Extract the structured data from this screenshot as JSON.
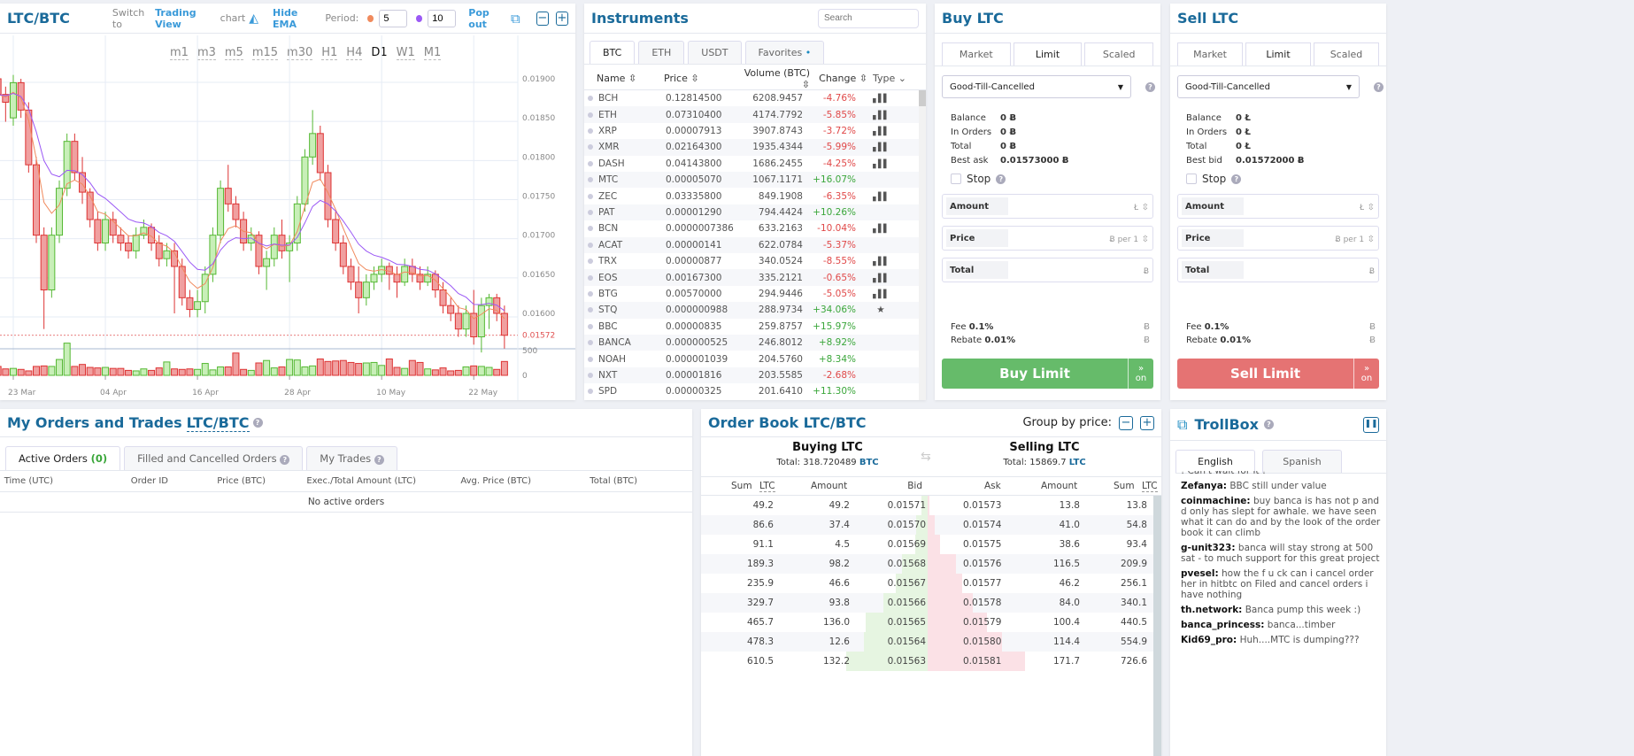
{
  "chart": {
    "title": "LTC/BTC",
    "switch_pre": "Switch to",
    "switch_link": "Trading View",
    "switch_post": "chart",
    "hide_ema": "Hide EMA",
    "period_label": "Period:",
    "ema_fast": "5",
    "ema_slow": "10",
    "ema_fast_color": "#f08a5d",
    "ema_slow_color": "#9b59f5",
    "pop_out": "Pop out",
    "timeframes": [
      "m1",
      "m3",
      "m5",
      "m15",
      "m30",
      "H1",
      "H4",
      "D1",
      "W1",
      "M1"
    ],
    "active_timeframe": "D1"
  },
  "chart_data": {
    "type": "candlestick",
    "up_color": "#7ad15a",
    "down_color": "#e05050",
    "y_ticks": [
      "0.01900",
      "0.01850",
      "0.01800",
      "0.01750",
      "0.01700",
      "0.01650",
      "0.01600"
    ],
    "last_price": "0.01572",
    "volume_ticks": [
      "500",
      "0"
    ],
    "x_ticks": [
      "23 Mar",
      "04 Apr",
      "16 Apr",
      "28 Apr",
      "10 May",
      "22 May"
    ],
    "candles_columns": [
      "date",
      "open",
      "high",
      "low",
      "close",
      "volume"
    ],
    "candles": [
      [
        "21 Mar",
        0.019,
        0.01915,
        0.0186,
        0.0188,
        180
      ],
      [
        "22 Mar",
        0.0188,
        0.0189,
        0.01845,
        0.0187,
        130
      ],
      [
        "23 Mar",
        0.0185,
        0.01905,
        0.0184,
        0.01895,
        140
      ],
      [
        "24 Mar",
        0.01895,
        0.019,
        0.0185,
        0.0186,
        120
      ],
      [
        "25 Mar",
        0.0186,
        0.0187,
        0.0178,
        0.0179,
        90
      ],
      [
        "26 Mar",
        0.0179,
        0.018,
        0.0169,
        0.017,
        180
      ],
      [
        "27 Mar",
        0.017,
        0.0171,
        0.0158,
        0.0163,
        190
      ],
      [
        "28 Mar",
        0.0163,
        0.0171,
        0.0162,
        0.017,
        180
      ],
      [
        "29 Mar",
        0.017,
        0.0177,
        0.0169,
        0.0176,
        320
      ],
      [
        "30 Mar",
        0.0176,
        0.0183,
        0.0175,
        0.0182,
        650
      ],
      [
        "31 Mar",
        0.0182,
        0.0183,
        0.0177,
        0.0178,
        180
      ],
      [
        "01 Apr",
        0.0178,
        0.018,
        0.0174,
        0.01755,
        220
      ],
      [
        "02 Apr",
        0.01755,
        0.0176,
        0.0171,
        0.0172,
        160
      ],
      [
        "03 Apr",
        0.0172,
        0.0173,
        0.0168,
        0.0169,
        150
      ],
      [
        "04 Apr",
        0.0169,
        0.0173,
        0.0168,
        0.0172,
        160
      ],
      [
        "05 Apr",
        0.0172,
        0.0173,
        0.0169,
        0.017,
        140
      ],
      [
        "06 Apr",
        0.017,
        0.0171,
        0.0168,
        0.0169,
        140
      ],
      [
        "07 Apr",
        0.0169,
        0.017,
        0.0167,
        0.0168,
        100
      ],
      [
        "08 Apr",
        0.0168,
        0.0171,
        0.0167,
        0.017,
        90
      ],
      [
        "09 Apr",
        0.017,
        0.0172,
        0.01695,
        0.0171,
        130
      ],
      [
        "10 Apr",
        0.0171,
        0.01715,
        0.0168,
        0.0169,
        100
      ],
      [
        "11 Apr",
        0.0169,
        0.017,
        0.0166,
        0.0167,
        150
      ],
      [
        "12 Apr",
        0.0167,
        0.0169,
        0.0166,
        0.0168,
        270
      ],
      [
        "13 Apr",
        0.0168,
        0.0169,
        0.016,
        0.0166,
        130
      ],
      [
        "14 Apr",
        0.0166,
        0.0167,
        0.0161,
        0.0162,
        120
      ],
      [
        "15 Apr",
        0.0162,
        0.0163,
        0.01595,
        0.01605,
        130
      ],
      [
        "16 Apr",
        0.01605,
        0.0163,
        0.01595,
        0.01615,
        120
      ],
      [
        "17 Apr",
        0.01615,
        0.0166,
        0.016,
        0.0165,
        240
      ],
      [
        "18 Apr",
        0.0165,
        0.0171,
        0.0164,
        0.017,
        110
      ],
      [
        "19 Apr",
        0.017,
        0.0177,
        0.0169,
        0.0176,
        170
      ],
      [
        "20 Apr",
        0.0176,
        0.0179,
        0.0173,
        0.0174,
        170
      ],
      [
        "21 Apr",
        0.0174,
        0.0175,
        0.0171,
        0.0172,
        450
      ],
      [
        "22 Apr",
        0.0172,
        0.0173,
        0.0168,
        0.0169,
        120
      ],
      [
        "23 Apr",
        0.0169,
        0.0171,
        0.0168,
        0.017,
        100
      ],
      [
        "24 Apr",
        0.017,
        0.01705,
        0.0165,
        0.0166,
        250
      ],
      [
        "25 Apr",
        0.0166,
        0.0168,
        0.0163,
        0.0167,
        300
      ],
      [
        "26 Apr",
        0.0167,
        0.0171,
        0.0166,
        0.017,
        150
      ],
      [
        "27 Apr",
        0.017,
        0.0172,
        0.0167,
        0.0168,
        170
      ],
      [
        "28 Apr",
        0.0168,
        0.017,
        0.0164,
        0.0169,
        320
      ],
      [
        "29 Apr",
        0.0169,
        0.0175,
        0.0168,
        0.0174,
        310
      ],
      [
        "30 Apr",
        0.0174,
        0.0181,
        0.0173,
        0.018,
        170
      ],
      [
        "01 May",
        0.018,
        0.0186,
        0.0179,
        0.0183,
        190
      ],
      [
        "02 May",
        0.0183,
        0.0184,
        0.0177,
        0.0178,
        330
      ],
      [
        "03 May",
        0.0178,
        0.0179,
        0.0171,
        0.0172,
        280
      ],
      [
        "04 May",
        0.0172,
        0.0173,
        0.0168,
        0.0169,
        290
      ],
      [
        "05 May",
        0.0169,
        0.017,
        0.0165,
        0.0166,
        300
      ],
      [
        "06 May",
        0.0166,
        0.0167,
        0.0163,
        0.0164,
        260
      ],
      [
        "07 May",
        0.0164,
        0.0166,
        0.016,
        0.0162,
        240
      ],
      [
        "08 May",
        0.0162,
        0.0165,
        0.0161,
        0.0164,
        250
      ],
      [
        "09 May",
        0.0164,
        0.0166,
        0.0163,
        0.0165,
        260
      ],
      [
        "10 May",
        0.0165,
        0.0167,
        0.0164,
        0.0166,
        200
      ],
      [
        "11 May",
        0.0166,
        0.01665,
        0.0163,
        0.0165,
        330
      ],
      [
        "12 May",
        0.0165,
        0.0166,
        0.0162,
        0.0164,
        160
      ],
      [
        "13 May",
        0.0164,
        0.0167,
        0.01635,
        0.0166,
        140
      ],
      [
        "14 May",
        0.0166,
        0.0167,
        0.0164,
        0.0165,
        300
      ],
      [
        "15 May",
        0.0165,
        0.0166,
        0.0163,
        0.0164,
        260
      ],
      [
        "16 May",
        0.0164,
        0.0166,
        0.01635,
        0.0165,
        130
      ],
      [
        "17 May",
        0.0165,
        0.01655,
        0.0162,
        0.0163,
        110
      ],
      [
        "18 May",
        0.0163,
        0.0164,
        0.016,
        0.0161,
        150
      ],
      [
        "19 May",
        0.0161,
        0.0162,
        0.0159,
        0.016,
        90
      ],
      [
        "20 May",
        0.016,
        0.0161,
        0.0157,
        0.0158,
        100
      ],
      [
        "21 May",
        0.0158,
        0.0161,
        0.0157,
        0.016,
        170
      ],
      [
        "22 May",
        0.016,
        0.0163,
        0.0156,
        0.0157,
        190
      ],
      [
        "23 May",
        0.0157,
        0.0162,
        0.0155,
        0.0161,
        180
      ],
      [
        "24 May",
        0.0161,
        0.01625,
        0.0158,
        0.0162,
        160
      ],
      [
        "25 May",
        0.0162,
        0.01625,
        0.0159,
        0.016,
        120
      ],
      [
        "26 May",
        0.016,
        0.0161,
        0.01555,
        0.01572,
        280
      ]
    ]
  },
  "instruments": {
    "title": "Instruments",
    "search_placeholder": "Search",
    "tabs": [
      "BTC",
      "ETH",
      "USDT",
      "Favorites"
    ],
    "active_tab": "BTC",
    "columns": [
      "Name",
      "Price",
      "Volume (BTC)",
      "Change",
      "Type"
    ],
    "rows": [
      [
        "BCH",
        "0.12814500",
        "6208.9457",
        "-4.76%",
        "chart"
      ],
      [
        "ETH",
        "0.07310400",
        "4174.7792",
        "-5.85%",
        "chart"
      ],
      [
        "XRP",
        "0.00007913",
        "3907.8743",
        "-3.72%",
        "chart"
      ],
      [
        "XMR",
        "0.02164300",
        "1935.4344",
        "-5.99%",
        "chart"
      ],
      [
        "DASH",
        "0.04143800",
        "1686.2455",
        "-4.25%",
        "chart"
      ],
      [
        "MTC",
        "0.00005070",
        "1067.1171",
        "+16.07%",
        ""
      ],
      [
        "ZEC",
        "0.03335800",
        "849.1908",
        "-6.35%",
        "chart"
      ],
      [
        "PAT",
        "0.00001290",
        "794.4424",
        "+10.26%",
        ""
      ],
      [
        "BCN",
        "0.0000007386",
        "633.2163",
        "-10.04%",
        "chart"
      ],
      [
        "ACAT",
        "0.00000141",
        "622.0784",
        "-5.37%",
        ""
      ],
      [
        "TRX",
        "0.00000877",
        "340.0524",
        "-8.55%",
        "chart"
      ],
      [
        "EOS",
        "0.00167300",
        "335.2121",
        "-0.65%",
        "chart"
      ],
      [
        "BTG",
        "0.00570000",
        "294.9446",
        "-5.05%",
        "chart"
      ],
      [
        "STQ",
        "0.000000988",
        "288.9734",
        "+34.06%",
        "star"
      ],
      [
        "BBC",
        "0.00000835",
        "259.8757",
        "+15.97%",
        ""
      ],
      [
        "BANCA",
        "0.000000525",
        "246.8012",
        "+8.92%",
        ""
      ],
      [
        "NOAH",
        "0.000001039",
        "204.5760",
        "+8.34%",
        ""
      ],
      [
        "NXT",
        "0.00001816",
        "203.5585",
        "-2.68%",
        ""
      ],
      [
        "SPD",
        "0.00000325",
        "201.6410",
        "+11.30%",
        ""
      ]
    ]
  },
  "buy": {
    "title": "Buy LTC",
    "tabs": [
      "Market",
      "Limit",
      "Scaled"
    ],
    "order_type": "Good-Till-Cancelled",
    "balance_rows": [
      [
        "Balance",
        "0 Ƀ"
      ],
      [
        "In Orders",
        "0 Ƀ"
      ],
      [
        "Total",
        "0 Ƀ"
      ],
      [
        "Best ask",
        "0.01573000 Ƀ"
      ]
    ],
    "stop": "Stop",
    "amount": "Amount",
    "amount_unit": "Ł",
    "price": "Price",
    "price_unit": "Ƀ per 1",
    "total": "Total",
    "total_unit": "Ƀ",
    "fee_label": "Fee",
    "fee": "0.1%",
    "fee_unit": "Ƀ",
    "rebate_label": "Rebate",
    "rebate": "0.01%",
    "rebate_unit": "Ƀ",
    "button": "Buy  Limit",
    "on": "on",
    "color": "#66bb6a"
  },
  "sell": {
    "title": "Sell LTC",
    "tabs": [
      "Market",
      "Limit",
      "Scaled"
    ],
    "order_type": "Good-Till-Cancelled",
    "balance_rows": [
      [
        "Balance",
        "0 Ł"
      ],
      [
        "In Orders",
        "0 Ł"
      ],
      [
        "Total",
        "0 Ł"
      ],
      [
        "Best bid",
        "0.01572000 Ƀ"
      ]
    ],
    "stop": "Stop",
    "amount": "Amount",
    "amount_unit": "Ł",
    "price": "Price",
    "price_unit": "Ƀ per 1",
    "total": "Total",
    "total_unit": "Ƀ",
    "fee_label": "Fee",
    "fee": "0.1%",
    "fee_unit": "Ƀ",
    "rebate_label": "Rebate",
    "rebate": "0.01%",
    "rebate_unit": "Ƀ",
    "button": "Sell  Limit",
    "on": "on",
    "color": "#e57373"
  },
  "orders": {
    "title": "My Orders and Trades",
    "pair": "LTC/BTC",
    "tabs": [
      "Active Orders",
      "Filled and Cancelled Orders",
      "My Trades"
    ],
    "active_count": "(0)",
    "columns": [
      "Time (UTC)",
      "Order ID",
      "Price (BTC)",
      "Exec./Total Amount (LTC)",
      "Avg. Price (BTC)",
      "Total (BTC)"
    ],
    "empty": "No active orders"
  },
  "orderbook": {
    "title": "Order Book LTC/BTC",
    "group_label": "Group by price:",
    "buying_title": "Buying LTC",
    "buying_total_label": "Total: 318.720489",
    "buying_total_unit": "BTC",
    "selling_title": "Selling LTC",
    "selling_total_label": "Total: 15869.7",
    "selling_total_unit": "LTC",
    "bid_columns": [
      "Sum",
      "LTC",
      "Amount",
      "Bid"
    ],
    "ask_columns": [
      "Ask",
      "Amount",
      "Sum",
      "LTC"
    ],
    "bids": [
      [
        "49.2",
        "49.2",
        "0.01571"
      ],
      [
        "86.6",
        "37.4",
        "0.01570"
      ],
      [
        "91.1",
        "4.5",
        "0.01569"
      ],
      [
        "189.3",
        "98.2",
        "0.01568"
      ],
      [
        "235.9",
        "46.6",
        "0.01567"
      ],
      [
        "329.7",
        "93.8",
        "0.01566"
      ],
      [
        "465.7",
        "136.0",
        "0.01565"
      ],
      [
        "478.3",
        "12.6",
        "0.01564"
      ],
      [
        "610.5",
        "132.2",
        "0.01563"
      ]
    ],
    "asks": [
      [
        "0.01573",
        "13.8",
        "13.8"
      ],
      [
        "0.01574",
        "41.0",
        "54.8"
      ],
      [
        "0.01575",
        "38.6",
        "93.4"
      ],
      [
        "0.01576",
        "116.5",
        "209.9"
      ],
      [
        "0.01577",
        "46.2",
        "256.1"
      ],
      [
        "0.01578",
        "84.0",
        "340.1"
      ],
      [
        "0.01579",
        "100.4",
        "440.5"
      ],
      [
        "0.01580",
        "114.4",
        "554.9"
      ],
      [
        "0.01581",
        "171.7",
        "726.6"
      ]
    ]
  },
  "trollbox": {
    "title": "TrollBox",
    "tabs": [
      "English",
      "Spanish"
    ],
    "partial": "! Can't wait for it !",
    "messages": [
      [
        "Zefanya:",
        "BBC still under value"
      ],
      [
        "coinmachine:",
        "buy banca is has not p and d only has slept for awhale. we have seen what it can do and by the look of the order book it can climb"
      ],
      [
        "g-unit323:",
        "banca will stay strong at 500 sat - to much support for this great project"
      ],
      [
        "pvesel:",
        "how the f u ck can i cancel order her in hitbtc on Filed and cancel orders i have nothing"
      ],
      [
        "th.network:",
        "Banca pump this week :)"
      ],
      [
        "banca_princess:",
        "banca...timber"
      ],
      [
        "Kid69_pro:",
        "Huh....MTC is dumping???"
      ]
    ]
  }
}
